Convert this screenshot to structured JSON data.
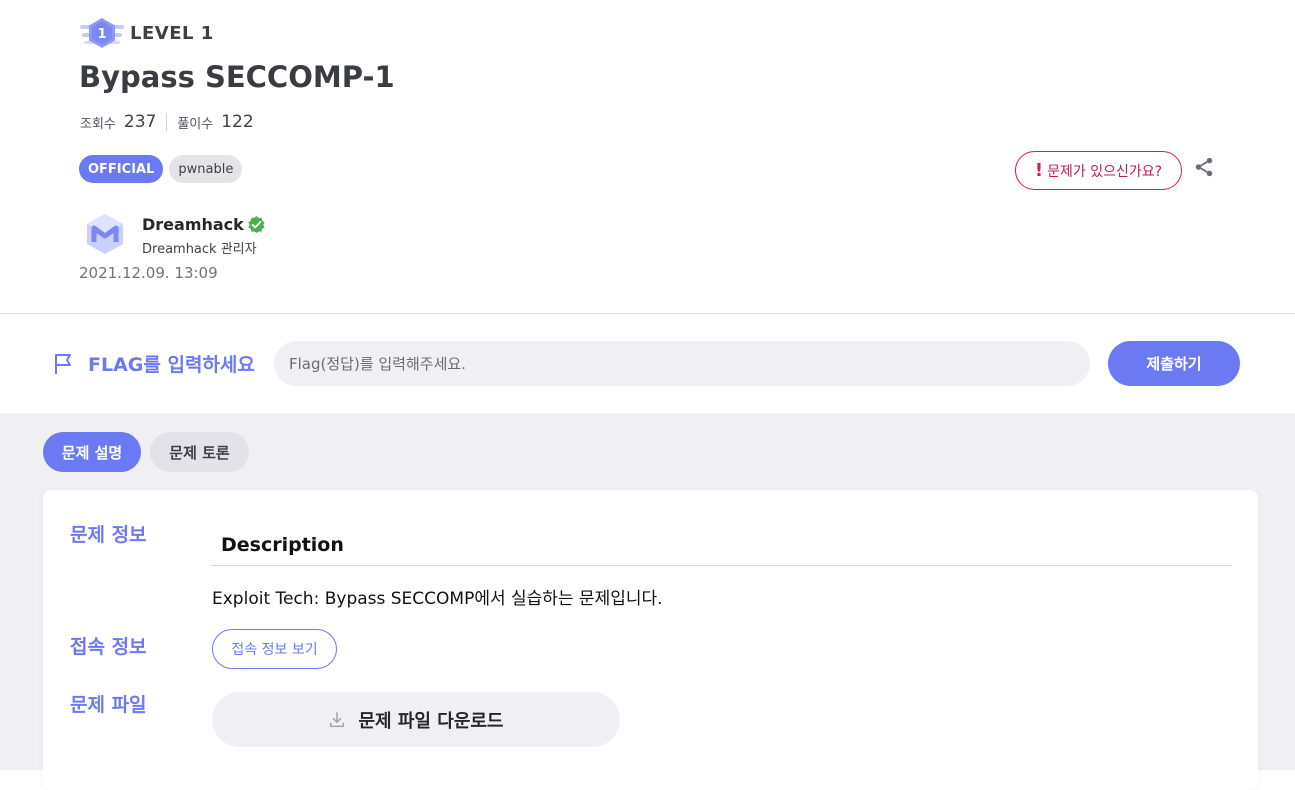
{
  "header": {
    "level_label": "LEVEL 1",
    "level_badge_number": "1",
    "title": "Bypass SECCOMP-1",
    "views_label": "조회수",
    "views_count": "237",
    "solves_label": "풀이수",
    "solves_count": "122",
    "tags": [
      "OFFICIAL",
      "pwnable"
    ],
    "report_button": "문제가 있으신가요?",
    "report_icon": "!",
    "share_icon": "share-icon"
  },
  "author": {
    "name": "Dreamhack",
    "role": "Dreamhack 관리자",
    "date": "2021.12.09. 13:09",
    "logo_icon": "dreamhack-logo",
    "verified_icon": "verified-badge-icon"
  },
  "flag": {
    "label": "FLAG를 입력하세요",
    "placeholder": "Flag(정답)를 입력해주세요.",
    "submit_label": "제출하기",
    "icon": "flag-icon"
  },
  "tabs": [
    {
      "label": "문제 설명",
      "active": true
    },
    {
      "label": "문제 토론",
      "active": false
    }
  ],
  "content": {
    "info_label": "문제 정보",
    "description_heading": "Description",
    "description_text": "Exploit Tech: Bypass SECCOMP에서 실습하는 문제입니다.",
    "connection_label": "접속 정보",
    "connection_button": "접속 정보 보기",
    "file_label": "문제 파일",
    "download_button": "문제 파일 다운로드",
    "download_icon": "download-icon"
  },
  "colors": {
    "accent": "#6b7af3",
    "report": "#d81b60",
    "verified": "#4caf50",
    "background_lower": "#f0f0f4"
  }
}
